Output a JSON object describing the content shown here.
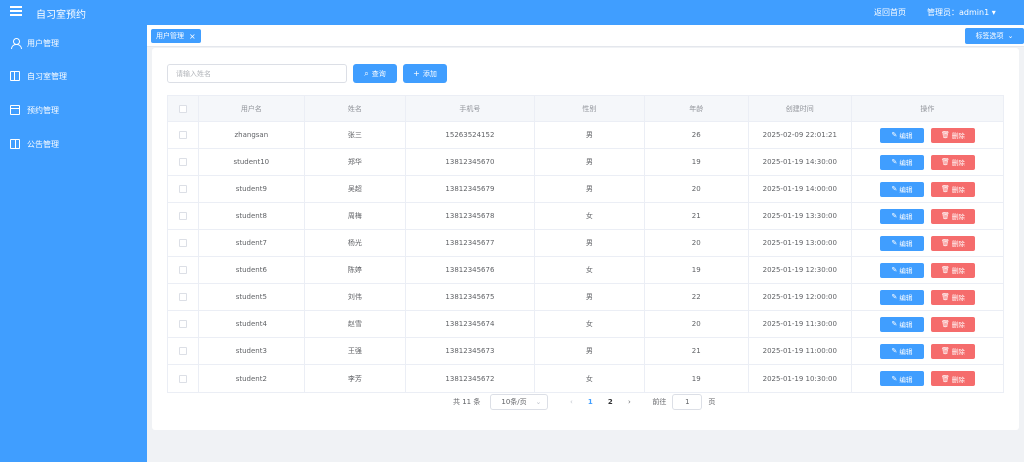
{
  "header": {
    "title": "自习室预约",
    "home_link": "返回首页",
    "admin": "管理员：admin1 ▾"
  },
  "sidebar": {
    "items": [
      {
        "label": "用户管理",
        "icon": "user-icon"
      },
      {
        "label": "自习室管理",
        "icon": "room-icon"
      },
      {
        "label": "预约管理",
        "icon": "calendar-icon"
      },
      {
        "label": "公告管理",
        "icon": "book-icon"
      }
    ]
  },
  "tabs": {
    "active_label": "用户管理",
    "close_glyph": "×",
    "options_label": "标签选项"
  },
  "toolbar": {
    "search_placeholder": "请输入姓名",
    "query_label": "查询",
    "add_label": "添加"
  },
  "table": {
    "columns": [
      "用户名",
      "姓名",
      "手机号",
      "性别",
      "年龄",
      "创建时间",
      "操作"
    ],
    "edit_label": "编辑",
    "delete_label": "删除",
    "rows": [
      {
        "username": "zhangsan",
        "name": "张三",
        "phone": "15263524152",
        "gender": "男",
        "age": "26",
        "created": "2025-02-09 22:01:21"
      },
      {
        "username": "student10",
        "name": "郑华",
        "phone": "13812345670",
        "gender": "男",
        "age": "19",
        "created": "2025-01-19 14:30:00"
      },
      {
        "username": "student9",
        "name": "吴超",
        "phone": "13812345679",
        "gender": "男",
        "age": "20",
        "created": "2025-01-19 14:00:00"
      },
      {
        "username": "student8",
        "name": "周梅",
        "phone": "13812345678",
        "gender": "女",
        "age": "21",
        "created": "2025-01-19 13:30:00"
      },
      {
        "username": "student7",
        "name": "杨光",
        "phone": "13812345677",
        "gender": "男",
        "age": "20",
        "created": "2025-01-19 13:00:00"
      },
      {
        "username": "student6",
        "name": "陈婷",
        "phone": "13812345676",
        "gender": "女",
        "age": "19",
        "created": "2025-01-19 12:30:00"
      },
      {
        "username": "student5",
        "name": "刘伟",
        "phone": "13812345675",
        "gender": "男",
        "age": "22",
        "created": "2025-01-19 12:00:00"
      },
      {
        "username": "student4",
        "name": "赵雪",
        "phone": "13812345674",
        "gender": "女",
        "age": "20",
        "created": "2025-01-19 11:30:00"
      },
      {
        "username": "student3",
        "name": "王强",
        "phone": "13812345673",
        "gender": "男",
        "age": "21",
        "created": "2025-01-19 11:00:00"
      },
      {
        "username": "student2",
        "name": "李芳",
        "phone": "13812345672",
        "gender": "女",
        "age": "19",
        "created": "2025-01-19 10:30:00"
      }
    ]
  },
  "pagination": {
    "total_text": "共 11 条",
    "page_size": "10条/页",
    "pages": [
      "1",
      "2"
    ],
    "current_page": "1",
    "goto_label": "前往",
    "goto_value": "1",
    "page_unit": "页"
  }
}
